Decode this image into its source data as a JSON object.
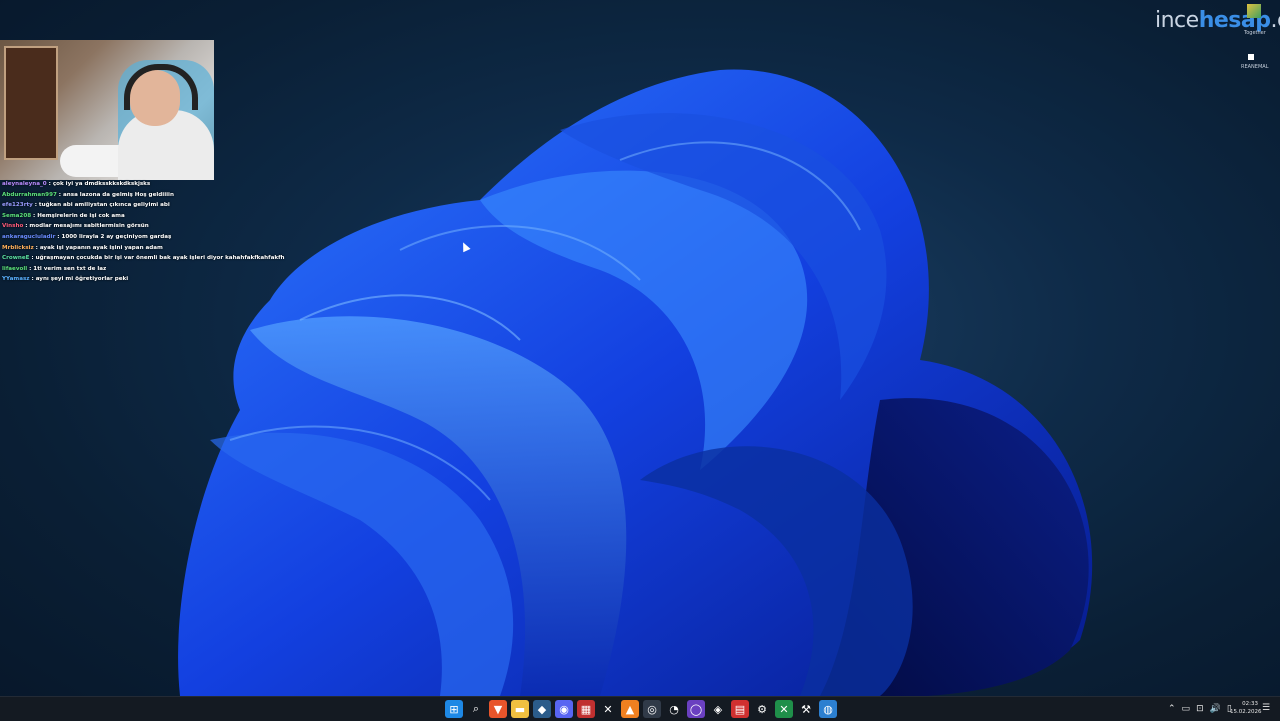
{
  "logo": {
    "part1": "ince",
    "part2": "hesap",
    "part3": ".com"
  },
  "corner_labels": {
    "top": "Together",
    "bottom": "REANEMAL"
  },
  "chat": [
    {
      "user": "aleynaleyna_0",
      "user_color": "#b98cff",
      "message": ": çok iyi ya dmdksskkskdkskjsks"
    },
    {
      "user": "Abdurrahman997",
      "user_color": "#5be07a",
      "message": ": ansa lazona da gelmiş Hoş geldiiiin"
    },
    {
      "user": "efe123rty",
      "user_color": "#9a9cff",
      "message": ": tuğkan abi amiliystan çıkınca geliyimi abi"
    },
    {
      "user": "Sema208",
      "user_color": "#5be07a",
      "message": ": Hemşirelerin de işi cok ama"
    },
    {
      "user": "Vinsho",
      "user_color": "#ff5b7a",
      "message": ": modlar mesajımı sabitlermisin görsün"
    },
    {
      "user": "ankaragucluladir",
      "user_color": "#6a8cff",
      "message": ": 1000 liraylа 2 ay geçiniyom gardaş"
    },
    {
      "user": "Mrblicksiz",
      "user_color": "#ffb05b",
      "message": ": ayak işi yapanın ayak işini yapan adam"
    },
    {
      "user": "CrowneE",
      "user_color": "#5be0a0",
      "message": ": uğraşmayan çocukda bir işi var önemli bak ayak işleri diyor kahahfakfkahfakfh"
    },
    {
      "user": "lifaevoll",
      "user_color": "#5be07a",
      "message": ": 1tl verim sen txt de laz"
    },
    {
      "user": "YYamasz",
      "user_color": "#5ab0ff",
      "message": ": aynı şeyi mi öğretiyorlar peki"
    }
  ],
  "taskbar": {
    "apps": [
      {
        "name": "start-icon",
        "glyph": "⊞",
        "bg": "#1e88e5"
      },
      {
        "name": "search-icon",
        "glyph": "⌕",
        "bg": "transparent"
      },
      {
        "name": "brave-icon",
        "glyph": "▼",
        "bg": "#e8552b"
      },
      {
        "name": "file-explorer-icon",
        "glyph": "▬",
        "bg": "#f0c040"
      },
      {
        "name": "steam-icon",
        "glyph": "◆",
        "bg": "#2b5c8a"
      },
      {
        "name": "discord-icon",
        "glyph": "◉",
        "bg": "#5865f2"
      },
      {
        "name": "calendar-icon",
        "glyph": "▦",
        "bg": "#c03030"
      },
      {
        "name": "x-app-icon",
        "glyph": "✕",
        "bg": "transparent"
      },
      {
        "name": "vlc-icon",
        "glyph": "▲",
        "bg": "#f08020"
      },
      {
        "name": "streamdeck-icon",
        "glyph": "◎",
        "bg": "#303a48"
      },
      {
        "name": "gauge-icon",
        "glyph": "◔",
        "bg": "transparent"
      },
      {
        "name": "obs-icon",
        "glyph": "◯",
        "bg": "#6a40c0"
      },
      {
        "name": "ticket-icon",
        "glyph": "◈",
        "bg": "transparent"
      },
      {
        "name": "pdf-icon",
        "glyph": "▤",
        "bg": "#d03030"
      },
      {
        "name": "settings-icon",
        "glyph": "⚙",
        "bg": "transparent"
      },
      {
        "name": "excel-icon",
        "glyph": "✕",
        "bg": "#1f8f4a"
      },
      {
        "name": "tool-icon",
        "glyph": "⚒",
        "bg": "transparent"
      },
      {
        "name": "browser-icon",
        "glyph": "◍",
        "bg": "#2c7fd0"
      }
    ],
    "tray": [
      "⌃",
      "▭",
      "⊡",
      "🔊",
      "▯"
    ],
    "time": "02:33",
    "date": "15.02.2026",
    "notification_glyph": "☰"
  }
}
